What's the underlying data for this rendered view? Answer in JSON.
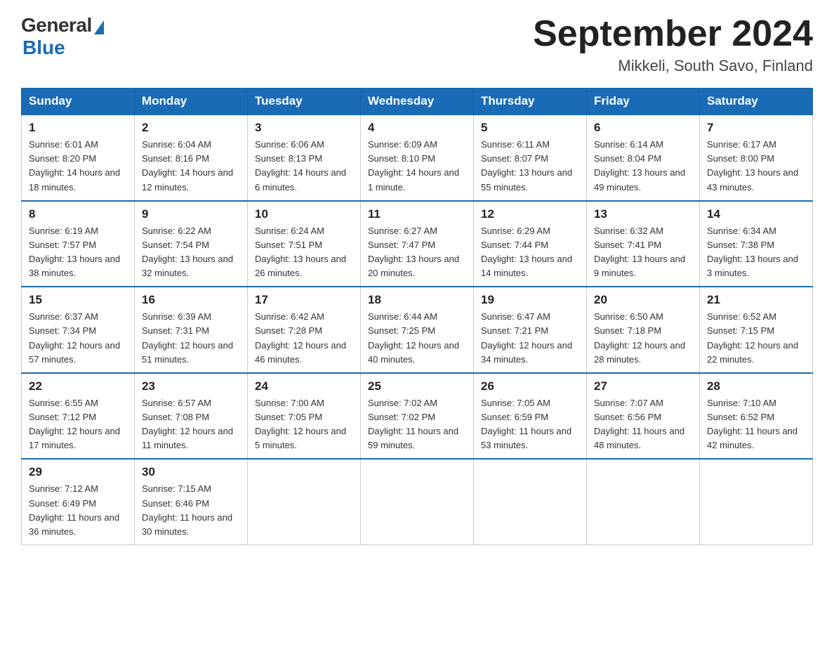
{
  "logo": {
    "general": "General",
    "blue": "Blue"
  },
  "title": "September 2024",
  "location": "Mikkeli, South Savo, Finland",
  "headers": [
    "Sunday",
    "Monday",
    "Tuesday",
    "Wednesday",
    "Thursday",
    "Friday",
    "Saturday"
  ],
  "weeks": [
    [
      {
        "day": "1",
        "sunrise": "6:01 AM",
        "sunset": "8:20 PM",
        "daylight": "14 hours and 18 minutes."
      },
      {
        "day": "2",
        "sunrise": "6:04 AM",
        "sunset": "8:16 PM",
        "daylight": "14 hours and 12 minutes."
      },
      {
        "day": "3",
        "sunrise": "6:06 AM",
        "sunset": "8:13 PM",
        "daylight": "14 hours and 6 minutes."
      },
      {
        "day": "4",
        "sunrise": "6:09 AM",
        "sunset": "8:10 PM",
        "daylight": "14 hours and 1 minute."
      },
      {
        "day": "5",
        "sunrise": "6:11 AM",
        "sunset": "8:07 PM",
        "daylight": "13 hours and 55 minutes."
      },
      {
        "day": "6",
        "sunrise": "6:14 AM",
        "sunset": "8:04 PM",
        "daylight": "13 hours and 49 minutes."
      },
      {
        "day": "7",
        "sunrise": "6:17 AM",
        "sunset": "8:00 PM",
        "daylight": "13 hours and 43 minutes."
      }
    ],
    [
      {
        "day": "8",
        "sunrise": "6:19 AM",
        "sunset": "7:57 PM",
        "daylight": "13 hours and 38 minutes."
      },
      {
        "day": "9",
        "sunrise": "6:22 AM",
        "sunset": "7:54 PM",
        "daylight": "13 hours and 32 minutes."
      },
      {
        "day": "10",
        "sunrise": "6:24 AM",
        "sunset": "7:51 PM",
        "daylight": "13 hours and 26 minutes."
      },
      {
        "day": "11",
        "sunrise": "6:27 AM",
        "sunset": "7:47 PM",
        "daylight": "13 hours and 20 minutes."
      },
      {
        "day": "12",
        "sunrise": "6:29 AM",
        "sunset": "7:44 PM",
        "daylight": "13 hours and 14 minutes."
      },
      {
        "day": "13",
        "sunrise": "6:32 AM",
        "sunset": "7:41 PM",
        "daylight": "13 hours and 9 minutes."
      },
      {
        "day": "14",
        "sunrise": "6:34 AM",
        "sunset": "7:38 PM",
        "daylight": "13 hours and 3 minutes."
      }
    ],
    [
      {
        "day": "15",
        "sunrise": "6:37 AM",
        "sunset": "7:34 PM",
        "daylight": "12 hours and 57 minutes."
      },
      {
        "day": "16",
        "sunrise": "6:39 AM",
        "sunset": "7:31 PM",
        "daylight": "12 hours and 51 minutes."
      },
      {
        "day": "17",
        "sunrise": "6:42 AM",
        "sunset": "7:28 PM",
        "daylight": "12 hours and 46 minutes."
      },
      {
        "day": "18",
        "sunrise": "6:44 AM",
        "sunset": "7:25 PM",
        "daylight": "12 hours and 40 minutes."
      },
      {
        "day": "19",
        "sunrise": "6:47 AM",
        "sunset": "7:21 PM",
        "daylight": "12 hours and 34 minutes."
      },
      {
        "day": "20",
        "sunrise": "6:50 AM",
        "sunset": "7:18 PM",
        "daylight": "12 hours and 28 minutes."
      },
      {
        "day": "21",
        "sunrise": "6:52 AM",
        "sunset": "7:15 PM",
        "daylight": "12 hours and 22 minutes."
      }
    ],
    [
      {
        "day": "22",
        "sunrise": "6:55 AM",
        "sunset": "7:12 PM",
        "daylight": "12 hours and 17 minutes."
      },
      {
        "day": "23",
        "sunrise": "6:57 AM",
        "sunset": "7:08 PM",
        "daylight": "12 hours and 11 minutes."
      },
      {
        "day": "24",
        "sunrise": "7:00 AM",
        "sunset": "7:05 PM",
        "daylight": "12 hours and 5 minutes."
      },
      {
        "day": "25",
        "sunrise": "7:02 AM",
        "sunset": "7:02 PM",
        "daylight": "11 hours and 59 minutes."
      },
      {
        "day": "26",
        "sunrise": "7:05 AM",
        "sunset": "6:59 PM",
        "daylight": "11 hours and 53 minutes."
      },
      {
        "day": "27",
        "sunrise": "7:07 AM",
        "sunset": "6:56 PM",
        "daylight": "11 hours and 48 minutes."
      },
      {
        "day": "28",
        "sunrise": "7:10 AM",
        "sunset": "6:52 PM",
        "daylight": "11 hours and 42 minutes."
      }
    ],
    [
      {
        "day": "29",
        "sunrise": "7:12 AM",
        "sunset": "6:49 PM",
        "daylight": "11 hours and 36 minutes."
      },
      {
        "day": "30",
        "sunrise": "7:15 AM",
        "sunset": "6:46 PM",
        "daylight": "11 hours and 30 minutes."
      },
      null,
      null,
      null,
      null,
      null
    ]
  ],
  "labels": {
    "sunrise": "Sunrise:",
    "sunset": "Sunset:",
    "daylight": "Daylight:"
  }
}
